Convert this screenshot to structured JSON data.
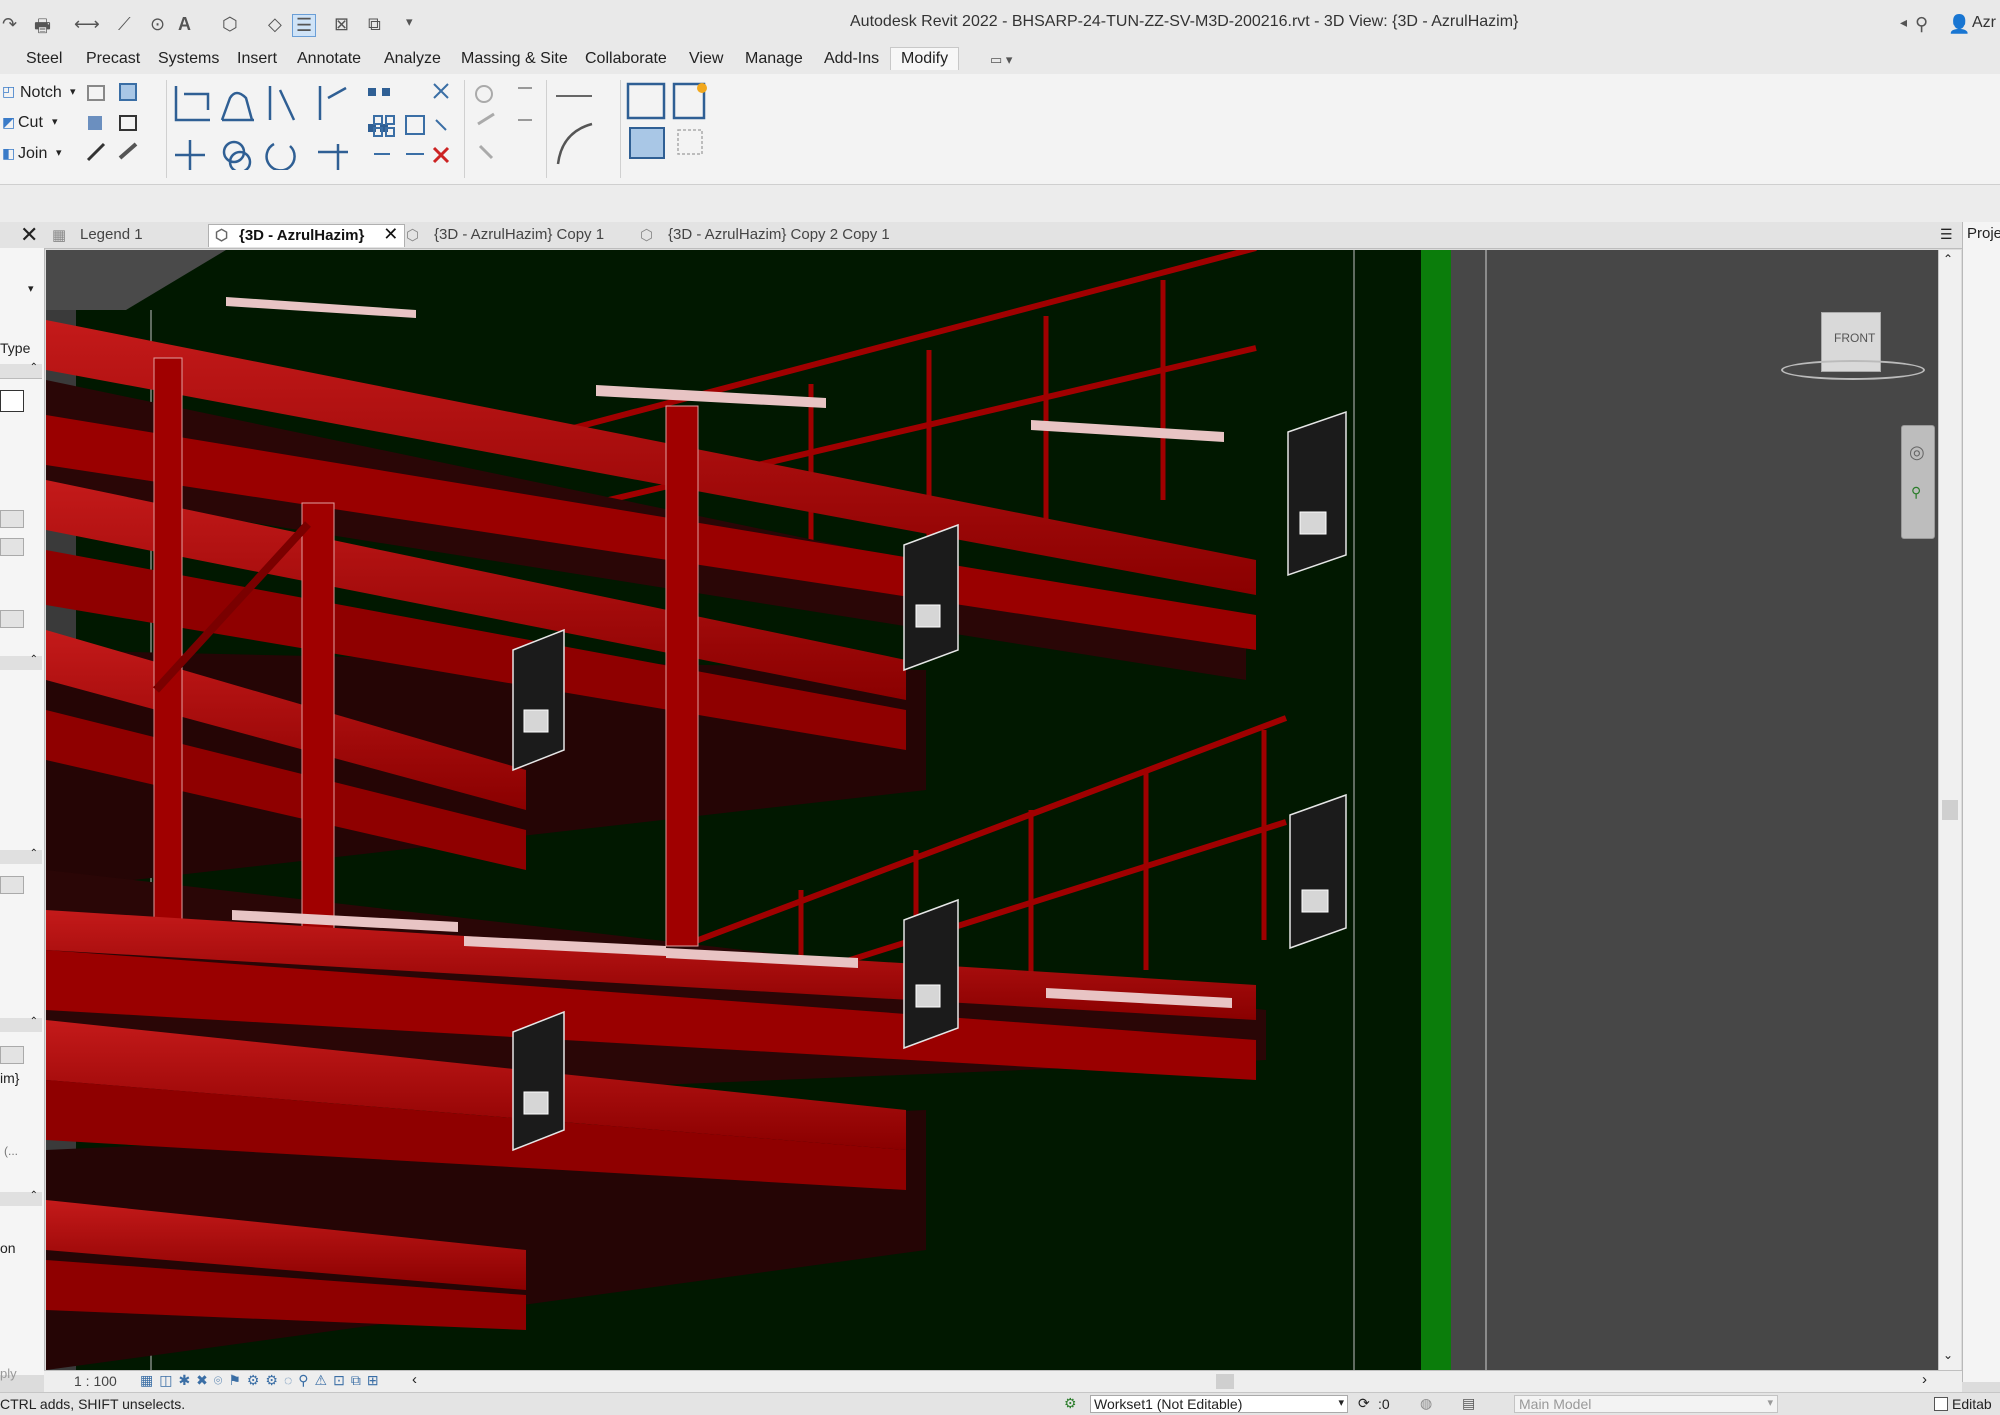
{
  "window": {
    "title": "Autodesk Revit 2022 - BHSARP-24-TUN-ZZ-SV-M3D-200216.rvt - 3D View: {3D - AzrulHazim}",
    "user": "Azr"
  },
  "menu": {
    "tabs": [
      "Steel",
      "Precast",
      "Systems",
      "Insert",
      "Annotate",
      "Analyze",
      "Massing & Site",
      "Collaborate",
      "View",
      "Manage",
      "Add-Ins",
      "Modify"
    ],
    "active": "Modify"
  },
  "ribbon": {
    "geometry": {
      "notch": "Notch",
      "cut": "Cut",
      "join": "Join"
    }
  },
  "view_tabs": [
    {
      "label": "Legend 1",
      "active": false
    },
    {
      "label": "{3D - AzrulHazim}",
      "active": true
    },
    {
      "label": "{3D - AzrulHazim} Copy 1",
      "active": false
    },
    {
      "label": "{3D - AzrulHazim} Copy 2 Copy 1",
      "active": false
    }
  ],
  "properties_panel": {
    "type_label": "Type",
    "view_name_fragment": "im}",
    "browse_fragment": "(...",
    "discipline_fragment": "on",
    "apply_fragment": "ply"
  },
  "project_browser": {
    "title_fragment": "Proje"
  },
  "viewcube": {
    "face": "FRONT"
  },
  "view_control": {
    "scale": "1 : 100"
  },
  "status": {
    "hint": "CTRL adds, SHIFT unselects.",
    "workset": "Workset1 (Not Editable)",
    "design_option": "Main Model",
    "editable_only": "Editab",
    "sync_count": ":0"
  },
  "colors": {
    "viewport_bg": "#011800",
    "steel": "#a00000",
    "steel_dark": "#560000",
    "plate": "#1b1b1b",
    "ribbon_bg": "#f3f3f3"
  }
}
